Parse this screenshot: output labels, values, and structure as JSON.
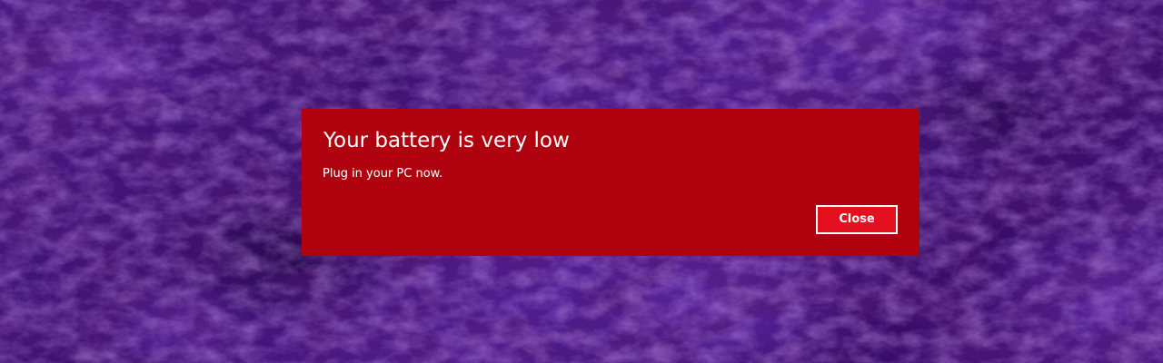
{
  "notification": {
    "title": "Your battery is very low",
    "message": "Plug in your PC now.",
    "close_label": "Close",
    "background_color": "#b0010f",
    "button_color": "#e5101f"
  },
  "wallpaper": {
    "base_color": "#4a1a86"
  }
}
